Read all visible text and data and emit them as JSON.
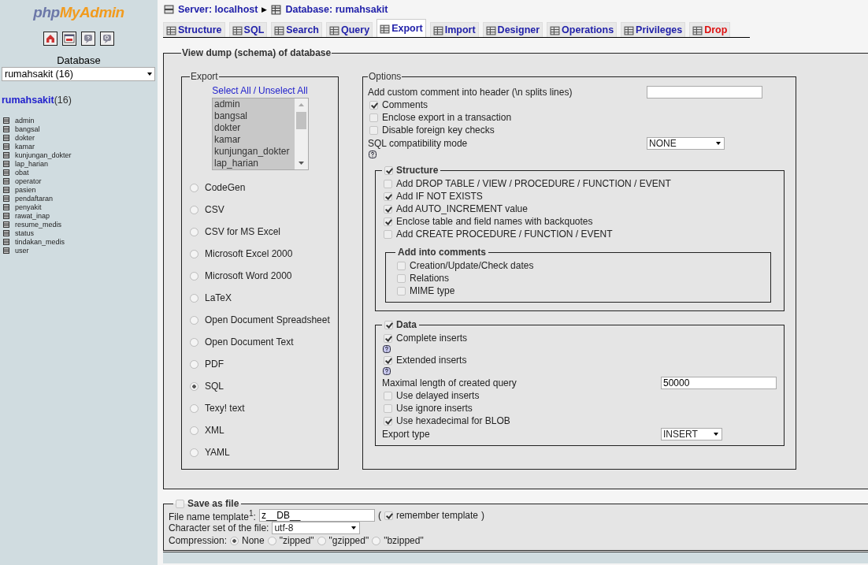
{
  "sidebar": {
    "logo": [
      "php",
      "MyAdmin"
    ],
    "database_label": "Database",
    "database_select": "rumahsakit (16)",
    "db_link": "rumahsakit",
    "db_count": "(16)",
    "tables": [
      "admin",
      "bangsal",
      "dokter",
      "kamar",
      "kunjungan_dokter",
      "lap_harian",
      "obat",
      "operator",
      "pasien",
      "pendaftaran",
      "penyakit",
      "rawat_inap",
      "resume_medis",
      "status",
      "tindakan_medis",
      "user"
    ]
  },
  "breadcrumb": {
    "server": "Server: localhost",
    "separator": "▶",
    "database": "Database: rumahsakit"
  },
  "tabs": [
    {
      "label": "Structure",
      "selected": false,
      "kind": "normal"
    },
    {
      "label": "SQL",
      "selected": false,
      "kind": "normal"
    },
    {
      "label": "Search",
      "selected": false,
      "kind": "normal"
    },
    {
      "label": "Query",
      "selected": false,
      "kind": "normal"
    },
    {
      "label": "Export",
      "selected": true,
      "kind": "normal"
    },
    {
      "label": "Import",
      "selected": false,
      "kind": "normal"
    },
    {
      "label": "Designer",
      "selected": false,
      "kind": "normal"
    },
    {
      "label": "Operations",
      "selected": false,
      "kind": "normal"
    },
    {
      "label": "Privileges",
      "selected": false,
      "kind": "normal"
    },
    {
      "label": "Drop",
      "selected": false,
      "kind": "danger"
    }
  ],
  "dump": {
    "legend": "View dump (schema) of database",
    "export": {
      "legend": "Export",
      "select_all": "Select All",
      "slash": "/",
      "unselect_all": "Unselect All",
      "tables": [
        {
          "label": "admin",
          "selected": true
        },
        {
          "label": "bangsal",
          "selected": true
        },
        {
          "label": "dokter",
          "selected": true
        },
        {
          "label": "kamar",
          "selected": true
        },
        {
          "label": "kunjungan_dokter",
          "selected": true
        },
        {
          "label": "lap_harian",
          "selected": true
        }
      ],
      "formats": [
        {
          "label": "CodeGen",
          "selected": false
        },
        {
          "label": "CSV",
          "selected": false
        },
        {
          "label": "CSV for MS Excel",
          "selected": false
        },
        {
          "label": "Microsoft Excel 2000",
          "selected": false
        },
        {
          "label": "Microsoft Word 2000",
          "selected": false
        },
        {
          "label": "LaTeX",
          "selected": false
        },
        {
          "label": "Open Document Spreadsheet",
          "selected": false
        },
        {
          "label": "Open Document Text",
          "selected": false
        },
        {
          "label": "PDF",
          "selected": false
        },
        {
          "label": "SQL",
          "selected": true
        },
        {
          "label": "Texy! text",
          "selected": false
        },
        {
          "label": "XML",
          "selected": false
        },
        {
          "label": "YAML",
          "selected": false
        }
      ]
    },
    "options": {
      "legend": "Options",
      "items": [
        {
          "kind": "field",
          "label": "Add custom comment into header (\\n splits lines)"
        },
        {
          "kind": "checkbox",
          "label": "Comments",
          "checked": true,
          "help": false
        },
        {
          "kind": "checkbox",
          "label": "Enclose export in a transaction",
          "checked": false,
          "help": false
        },
        {
          "kind": "checkbox",
          "label": "Disable foreign key checks",
          "checked": false,
          "help": false
        },
        {
          "kind": "select",
          "label": "SQL compatibility mode",
          "value": "NONE",
          "help": true
        }
      ],
      "structure": {
        "legend": "Structure",
        "checked": true,
        "items": [
          {
            "label": "Add DROP TABLE / VIEW / PROCEDURE / FUNCTION / EVENT",
            "checked": false
          },
          {
            "label": "Add IF NOT EXISTS",
            "checked": true
          },
          {
            "label": "Add AUTO_INCREMENT value",
            "checked": true
          },
          {
            "label": "Enclose table and field names with backquotes",
            "checked": true
          },
          {
            "label": "Add CREATE PROCEDURE / FUNCTION / EVENT",
            "checked": false
          }
        ],
        "comments": {
          "legend": "Add into comments",
          "items": [
            {
              "label": "Creation/Update/Check dates",
              "checked": false
            },
            {
              "label": "Relations",
              "checked": false
            },
            {
              "label": "MIME type",
              "checked": false
            }
          ]
        }
      },
      "data": {
        "legend": "Data",
        "checked": true,
        "items": [
          {
            "kind": "checkbox",
            "label": "Complete inserts",
            "checked": true,
            "help": true
          },
          {
            "kind": "checkbox",
            "label": "Extended inserts",
            "checked": true,
            "help": true
          },
          {
            "kind": "field",
            "label": "Maximal length of created query",
            "value": "50000"
          },
          {
            "kind": "checkbox",
            "label": "Use delayed inserts",
            "checked": false,
            "help": false
          },
          {
            "kind": "checkbox",
            "label": "Use ignore inserts",
            "checked": false,
            "help": false
          },
          {
            "kind": "checkbox",
            "label": "Use hexadecimal for BLOB",
            "checked": true,
            "help": false
          },
          {
            "kind": "select",
            "label": "Export type",
            "value": "INSERT",
            "help": false
          }
        ]
      }
    }
  },
  "save_file": {
    "legend": "Save as file",
    "checked": false,
    "filename_label": "File name template$^{1}$:",
    "filename_value": "z__DB__",
    "paren_open": "(",
    "remember": {
      "label": "remember template",
      "checked": true
    },
    "paren_close": ")",
    "charset_label": "Character set of the file:",
    "charset_value": "utf-8",
    "compression_label": "Compression:",
    "compression": [
      {
        "label": "None",
        "selected": true
      },
      {
        "label": "\"zipped\"",
        "selected": false
      },
      {
        "label": "\"gzipped\"",
        "selected": false
      },
      {
        "label": "\"bzipped\"",
        "selected": false
      }
    ]
  }
}
